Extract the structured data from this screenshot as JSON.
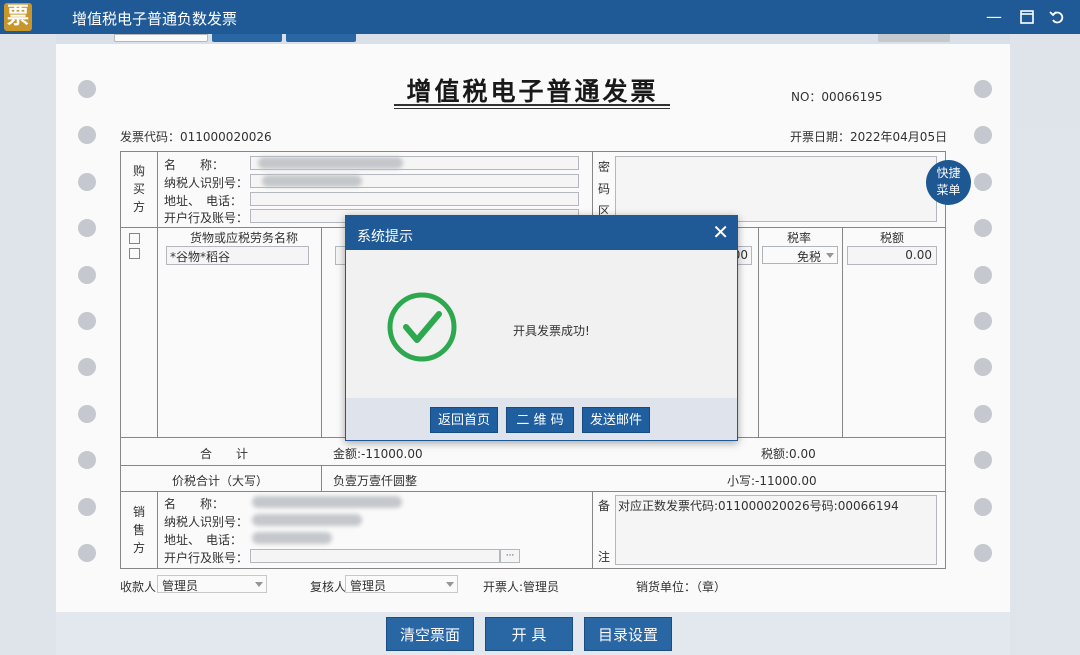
{
  "window": {
    "logo": "票",
    "title": "增值税电子普通负数发票"
  },
  "invoice": {
    "title": "增值税电子普通发票",
    "no": "NO：00066195",
    "code": "发票代码：011000020026",
    "date": "开票日期：2022年04月05日"
  },
  "buyer": {
    "section_label": "购买方",
    "name_label": "名　　称：",
    "tax_id_label": "纳税人识别号：",
    "address_label": "地址、　电话：",
    "bank_label": "开户行及账号：",
    "cipher_label": "密码区"
  },
  "quick_menu": "快捷菜单",
  "items": {
    "header_name": "货物或应税劳务名称",
    "header_tax_rate": "税率",
    "header_tax_amount": "税额",
    "row1_name": "*谷物*稻谷",
    "row1_price_tail": "00",
    "row1_tax_rate": "免税",
    "row1_tax_amount": "0.00"
  },
  "totals": {
    "label": "合　　计",
    "amount": "金额:-11000.00",
    "tax": "税额:0.00",
    "total_label": "价税合计（大写）",
    "total_words": "负壹万壹仟圆整",
    "total_small": "小写:-11000.00"
  },
  "seller": {
    "section_label": "销售方",
    "name_label": "名　　称：",
    "tax_id_label": "纳税人识别号：",
    "address_label": "地址、　电话：",
    "bank_label": "开户行及账号：",
    "remark_label_1": "备",
    "remark_label_2": "注",
    "remark_text": "对应正数发票代码:011000020026号码:00066194",
    "ellipsis": "···"
  },
  "signoff": {
    "payee_label": "收款人:",
    "payee": "管理员",
    "reviewer_label": "复核人:",
    "reviewer": "管理员",
    "issuer": "开票人:管理员",
    "seller_unit": "销货单位：（章）"
  },
  "footer_buttons": {
    "clear": "清空票面",
    "issue": "开 具",
    "catalog": "目录设置"
  },
  "dialog": {
    "title": "系统提示",
    "close": "✕",
    "message": "开具发票成功!",
    "btn_home": "返回首页",
    "btn_qr": "二 维 码",
    "btn_mail": "发送邮件"
  },
  "colors": {
    "brand": "#1f5a96",
    "success": "#2ea84f",
    "button": "#2a6aa8"
  },
  "icons": {
    "minimize": "minimize-icon",
    "maximize": "maximize-icon",
    "restore": "restore-icon",
    "close": "close-icon",
    "success": "check-circle-icon"
  }
}
